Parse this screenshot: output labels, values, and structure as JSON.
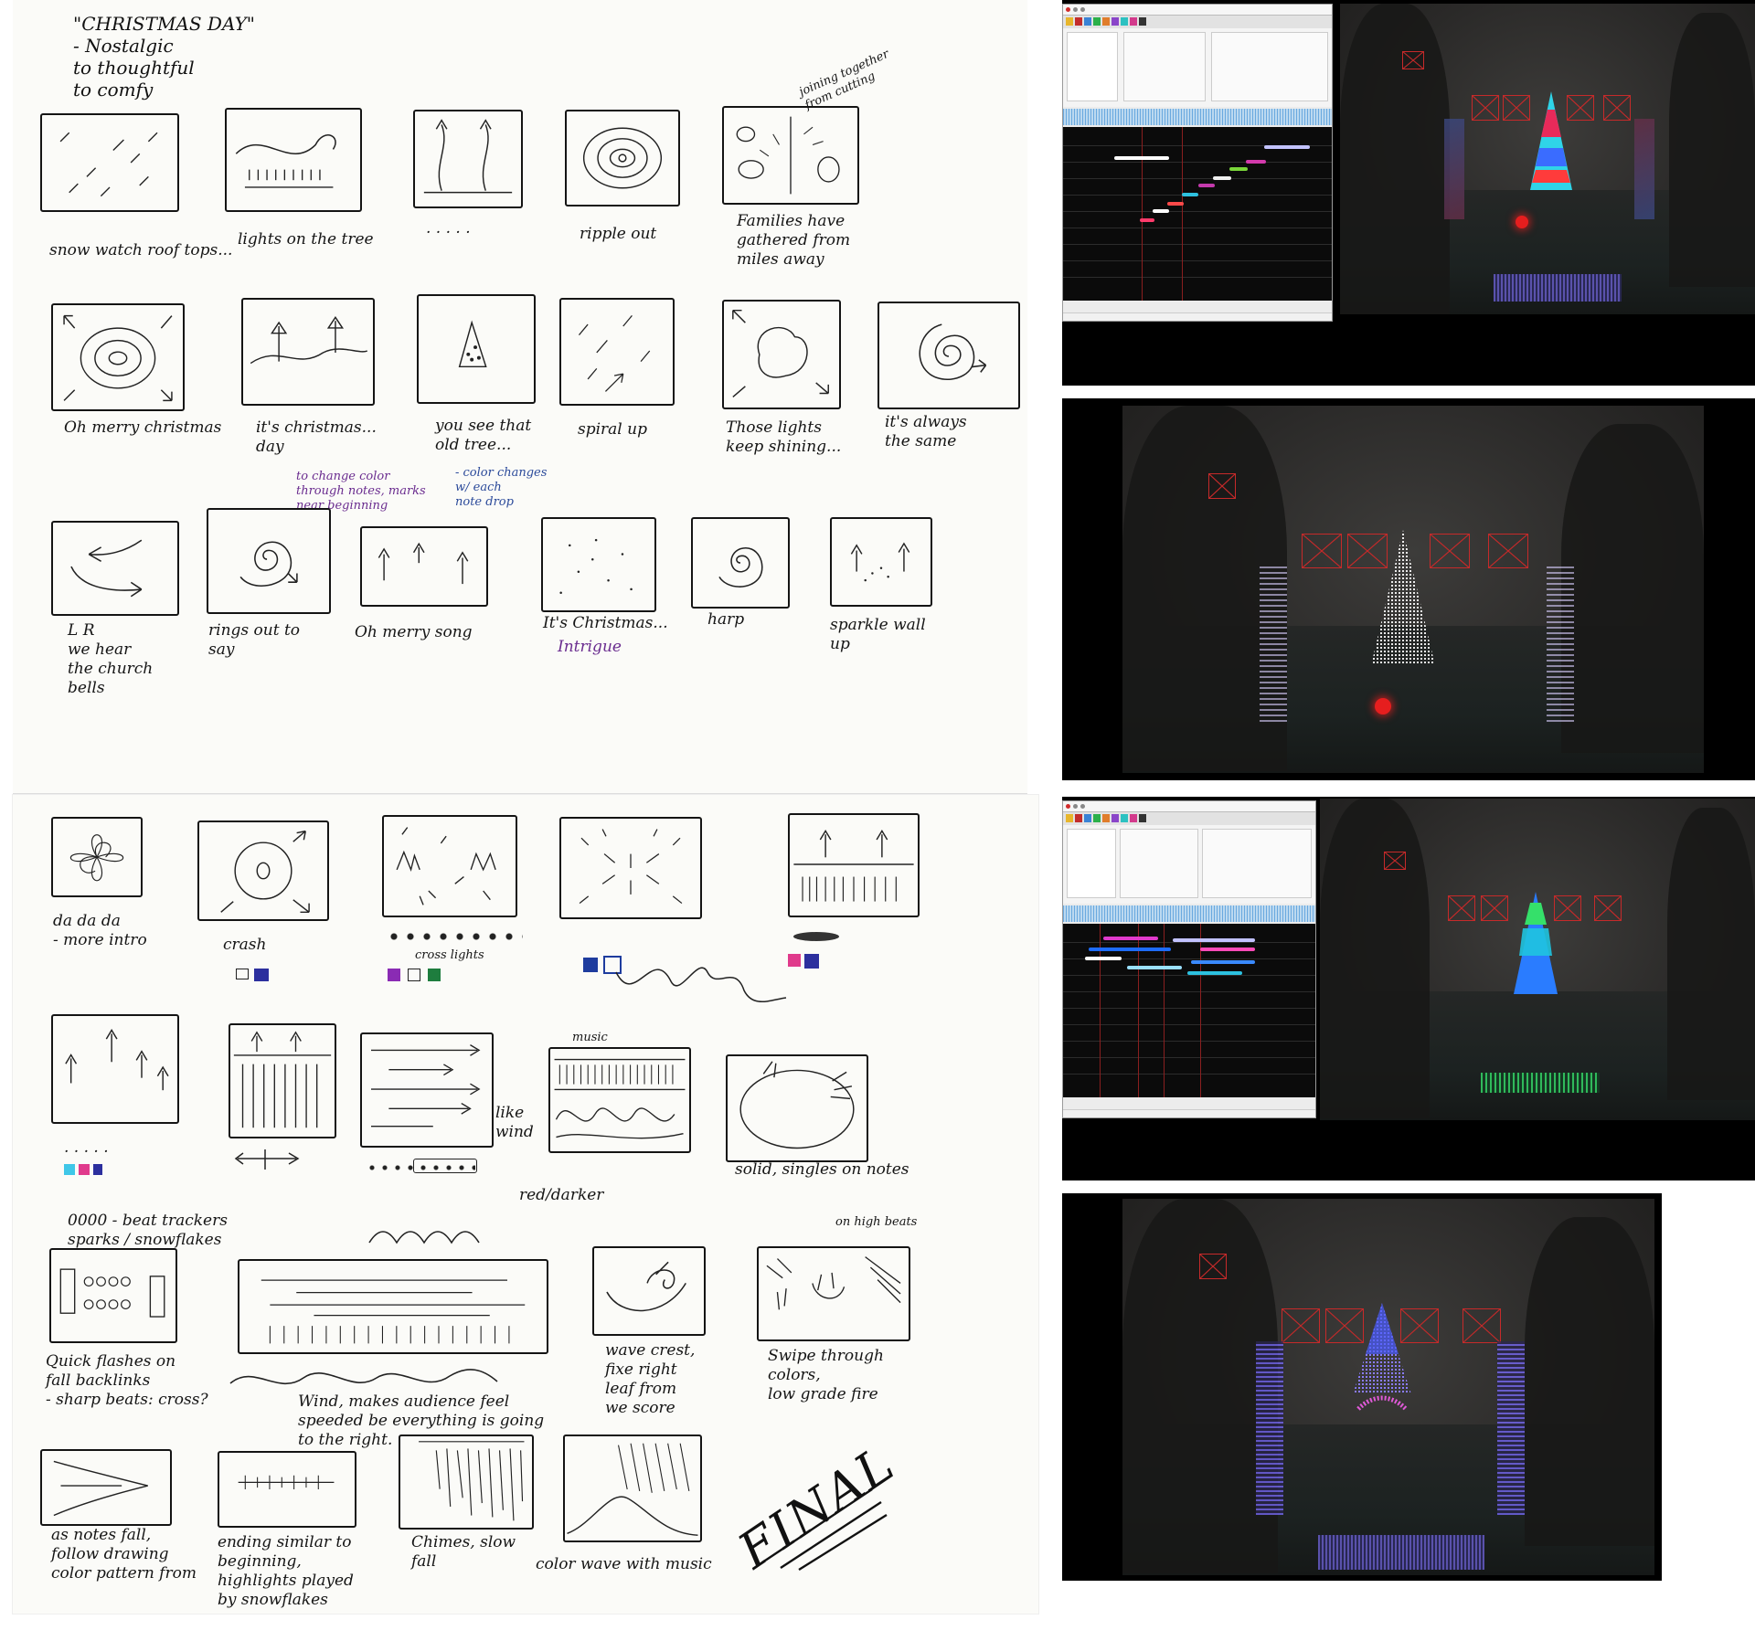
{
  "sheet_top": {
    "title_note": "\"CHRISTMAS DAY\"\n- Nostalgic\nto thoughtful\nto comfy",
    "row1": [
      {
        "caption": "snow watch roof tops..."
      },
      {
        "caption": "lights on the tree"
      },
      {
        "caption": ". . . . ."
      },
      {
        "caption": "ripple out"
      },
      {
        "caption": "Families have\ngathered from\nmiles away",
        "note": "joining together\nfrom cutting"
      }
    ],
    "row2": [
      {
        "caption": "Oh merry christmas"
      },
      {
        "caption": "it's christmas...\nday",
        "note": "to change color\nthrough notes, marks\nnear beginning"
      },
      {
        "caption": "you see that\nold tree...",
        "note": "- color changes\nw/ each\nnote drop"
      },
      {
        "caption": "spiral up"
      },
      {
        "caption": "Those lights\nkeep shining..."
      },
      {
        "caption": "it's always\nthe same"
      }
    ],
    "row3": [
      {
        "caption": "L   R\nwe hear\nthe church\nbells"
      },
      {
        "caption": "rings out to\nsay"
      },
      {
        "caption": "Oh      merry  song"
      },
      {
        "caption": "It's Christmas...",
        "note": "Intrigue"
      },
      {
        "caption": "harp"
      },
      {
        "caption": "sparkle wall\nup"
      }
    ]
  },
  "sheet_bottom": {
    "row1": [
      {
        "caption": "da da da\n- more intro"
      },
      {
        "caption": "crash"
      },
      {
        "caption": "cross lights"
      },
      {
        "caption": "music"
      },
      {
        "caption": ""
      }
    ],
    "row2": [
      {
        "caption": ". . . . ."
      },
      {
        "caption": ""
      },
      {
        "caption": "like\nwind",
        "note": "red/darker"
      },
      {
        "caption": ""
      },
      {
        "caption": "solid, singles on notes"
      }
    ],
    "row3": [
      {
        "caption": "Quick flashes on\nfall backlinks\n- sharp beats: cross?",
        "note": "0000 - beat trackers\nsparks / snowflakes"
      },
      {
        "caption": "Wind, makes audience feel\nspeeded be everything is going\nto the right."
      },
      {
        "caption": "wave crest,\nfixe right\nleaf from\nwe score"
      },
      {
        "caption": "Swipe through\ncolors,\nlow grade fire",
        "note": "on high beats"
      }
    ],
    "row4": [
      {
        "caption": "as notes fall,\nfollow drawing\ncolor pattern from"
      },
      {
        "caption": "ending similar to\nbeginning,\nhighlights played\nby snowflakes"
      },
      {
        "caption": "Chimes, slow\nfall"
      },
      {
        "caption": "color wave with music"
      },
      {
        "caption": "FINAL"
      }
    ]
  },
  "screenshots": [
    {
      "tree_colors": [
        "#2fd4e8",
        "#e82a5a",
        "#3a6cff",
        "#ff3b3b"
      ],
      "has_app_window": true
    },
    {
      "tree_colors": [
        "#ffffff",
        "#f0e8ff"
      ],
      "has_app_window": false
    },
    {
      "tree_colors": [
        "#35e06a",
        "#1fc4e0",
        "#2a7cff"
      ],
      "has_app_window": true
    },
    {
      "tree_colors": [
        "#4a5cff",
        "#b64cff",
        "#e05ad8"
      ],
      "has_app_window": false
    }
  ],
  "colors": {
    "ink": "#141414",
    "purple_ink": "#6a2c8f",
    "blue_ink": "#2b4a9a",
    "led_box": "#c62a2a"
  }
}
